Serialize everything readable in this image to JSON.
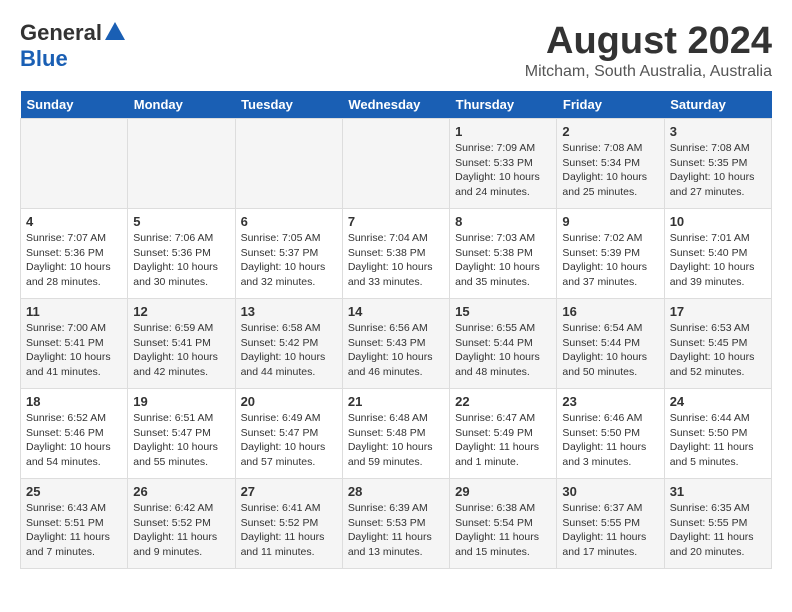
{
  "header": {
    "logo_general": "General",
    "logo_blue": "Blue",
    "main_title": "August 2024",
    "subtitle": "Mitcham, South Australia, Australia"
  },
  "columns": [
    "Sunday",
    "Monday",
    "Tuesday",
    "Wednesday",
    "Thursday",
    "Friday",
    "Saturday"
  ],
  "rows": [
    [
      {
        "day": "",
        "info": ""
      },
      {
        "day": "",
        "info": ""
      },
      {
        "day": "",
        "info": ""
      },
      {
        "day": "",
        "info": ""
      },
      {
        "day": "1",
        "info": "Sunrise: 7:09 AM\nSunset: 5:33 PM\nDaylight: 10 hours\nand 24 minutes."
      },
      {
        "day": "2",
        "info": "Sunrise: 7:08 AM\nSunset: 5:34 PM\nDaylight: 10 hours\nand 25 minutes."
      },
      {
        "day": "3",
        "info": "Sunrise: 7:08 AM\nSunset: 5:35 PM\nDaylight: 10 hours\nand 27 minutes."
      }
    ],
    [
      {
        "day": "4",
        "info": "Sunrise: 7:07 AM\nSunset: 5:36 PM\nDaylight: 10 hours\nand 28 minutes."
      },
      {
        "day": "5",
        "info": "Sunrise: 7:06 AM\nSunset: 5:36 PM\nDaylight: 10 hours\nand 30 minutes."
      },
      {
        "day": "6",
        "info": "Sunrise: 7:05 AM\nSunset: 5:37 PM\nDaylight: 10 hours\nand 32 minutes."
      },
      {
        "day": "7",
        "info": "Sunrise: 7:04 AM\nSunset: 5:38 PM\nDaylight: 10 hours\nand 33 minutes."
      },
      {
        "day": "8",
        "info": "Sunrise: 7:03 AM\nSunset: 5:38 PM\nDaylight: 10 hours\nand 35 minutes."
      },
      {
        "day": "9",
        "info": "Sunrise: 7:02 AM\nSunset: 5:39 PM\nDaylight: 10 hours\nand 37 minutes."
      },
      {
        "day": "10",
        "info": "Sunrise: 7:01 AM\nSunset: 5:40 PM\nDaylight: 10 hours\nand 39 minutes."
      }
    ],
    [
      {
        "day": "11",
        "info": "Sunrise: 7:00 AM\nSunset: 5:41 PM\nDaylight: 10 hours\nand 41 minutes."
      },
      {
        "day": "12",
        "info": "Sunrise: 6:59 AM\nSunset: 5:41 PM\nDaylight: 10 hours\nand 42 minutes."
      },
      {
        "day": "13",
        "info": "Sunrise: 6:58 AM\nSunset: 5:42 PM\nDaylight: 10 hours\nand 44 minutes."
      },
      {
        "day": "14",
        "info": "Sunrise: 6:56 AM\nSunset: 5:43 PM\nDaylight: 10 hours\nand 46 minutes."
      },
      {
        "day": "15",
        "info": "Sunrise: 6:55 AM\nSunset: 5:44 PM\nDaylight: 10 hours\nand 48 minutes."
      },
      {
        "day": "16",
        "info": "Sunrise: 6:54 AM\nSunset: 5:44 PM\nDaylight: 10 hours\nand 50 minutes."
      },
      {
        "day": "17",
        "info": "Sunrise: 6:53 AM\nSunset: 5:45 PM\nDaylight: 10 hours\nand 52 minutes."
      }
    ],
    [
      {
        "day": "18",
        "info": "Sunrise: 6:52 AM\nSunset: 5:46 PM\nDaylight: 10 hours\nand 54 minutes."
      },
      {
        "day": "19",
        "info": "Sunrise: 6:51 AM\nSunset: 5:47 PM\nDaylight: 10 hours\nand 55 minutes."
      },
      {
        "day": "20",
        "info": "Sunrise: 6:49 AM\nSunset: 5:47 PM\nDaylight: 10 hours\nand 57 minutes."
      },
      {
        "day": "21",
        "info": "Sunrise: 6:48 AM\nSunset: 5:48 PM\nDaylight: 10 hours\nand 59 minutes."
      },
      {
        "day": "22",
        "info": "Sunrise: 6:47 AM\nSunset: 5:49 PM\nDaylight: 11 hours\nand 1 minute."
      },
      {
        "day": "23",
        "info": "Sunrise: 6:46 AM\nSunset: 5:50 PM\nDaylight: 11 hours\nand 3 minutes."
      },
      {
        "day": "24",
        "info": "Sunrise: 6:44 AM\nSunset: 5:50 PM\nDaylight: 11 hours\nand 5 minutes."
      }
    ],
    [
      {
        "day": "25",
        "info": "Sunrise: 6:43 AM\nSunset: 5:51 PM\nDaylight: 11 hours\nand 7 minutes."
      },
      {
        "day": "26",
        "info": "Sunrise: 6:42 AM\nSunset: 5:52 PM\nDaylight: 11 hours\nand 9 minutes."
      },
      {
        "day": "27",
        "info": "Sunrise: 6:41 AM\nSunset: 5:52 PM\nDaylight: 11 hours\nand 11 minutes."
      },
      {
        "day": "28",
        "info": "Sunrise: 6:39 AM\nSunset: 5:53 PM\nDaylight: 11 hours\nand 13 minutes."
      },
      {
        "day": "29",
        "info": "Sunrise: 6:38 AM\nSunset: 5:54 PM\nDaylight: 11 hours\nand 15 minutes."
      },
      {
        "day": "30",
        "info": "Sunrise: 6:37 AM\nSunset: 5:55 PM\nDaylight: 11 hours\nand 17 minutes."
      },
      {
        "day": "31",
        "info": "Sunrise: 6:35 AM\nSunset: 5:55 PM\nDaylight: 11 hours\nand 20 minutes."
      }
    ]
  ]
}
